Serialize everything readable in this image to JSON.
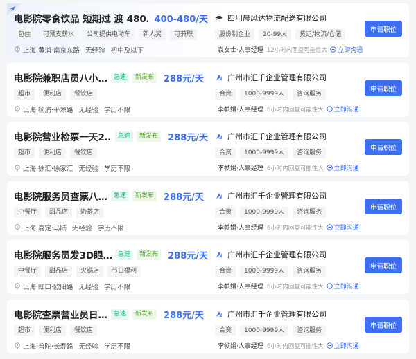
{
  "colors": {
    "accent": "#3d6ff0",
    "fast_badge": "#1fb58a",
    "new_badge": "#55a631"
  },
  "jobs": [
    {
      "title": "电影院零食饮品 短期过 渡 480…",
      "badges": [],
      "salary": "400-480/天",
      "tags": [
        "包住",
        "可预支薪水",
        "公司提供电动车",
        "新人奖",
        "可兼职"
      ],
      "location": "上海·黄浦·南京东路",
      "experience": "无经验",
      "education": "初中及以下",
      "company": "四川晨风达物流配送有限公司",
      "company_tags": [
        "股份制企业",
        "20-99人",
        "货运/物流/仓储"
      ],
      "hr": "袁女士·人事经理",
      "reply": "12小时内回复可能性大",
      "chat": "立即沟通",
      "apply": "申请职位"
    },
    {
      "title": "电影院兼职店员八小…",
      "badges": [
        "急速",
        "新发布"
      ],
      "salary": "288元/天",
      "tags": [
        "超市",
        "便利店",
        "餐饮店"
      ],
      "location": "上海·杨浦·平凉路",
      "experience": "无经验",
      "education": "学历不限",
      "company": "广州市汇千企业管理有限公司",
      "company_tags": [
        "合资",
        "1000-9999人",
        "咨询服务"
      ],
      "hr": "李帧娟·人事经理",
      "reply": "6小时内回复可能性大",
      "chat": "立即沟通",
      "apply": "申请职位"
    },
    {
      "title": "电影院营业检票一天2…",
      "badges": [
        "急速",
        "新发布"
      ],
      "salary": "288元/天",
      "tags": [
        "超市",
        "便利店",
        "餐饮店"
      ],
      "location": "上海·徐汇·徐家汇",
      "experience": "无经验",
      "education": "学历不限",
      "company": "广州市汇千企业管理有限公司",
      "company_tags": [
        "合资",
        "1000-9999人",
        "咨询服务"
      ],
      "hr": "李帧娟·人事经理",
      "reply": "6小时内回复可能性大",
      "chat": "立即沟通",
      "apply": "申请职位"
    },
    {
      "title": "电影院服务员查票八…",
      "badges": [
        "急速",
        "新发布"
      ],
      "salary": "288元/天",
      "tags": [
        "中餐厅",
        "甜品店",
        "奶茶店"
      ],
      "location": "上海·嘉定·马陆",
      "experience": "无经验",
      "education": "学历不限",
      "company": "广州市汇千企业管理有限公司",
      "company_tags": [
        "合资",
        "1000-9999人",
        "咨询服务"
      ],
      "hr": "李帧娟·人事经理",
      "reply": "6小时内回复可能性大",
      "chat": "立即沟通",
      "apply": "申请职位"
    },
    {
      "title": "电影院服务员发3D眼…",
      "badges": [
        "急速",
        "新发布"
      ],
      "salary": "288元/天",
      "tags": [
        "中餐厅",
        "甜品店",
        "火锅店",
        "节日福利"
      ],
      "location": "上海·虹口·欧阳路",
      "experience": "无经验",
      "education": "学历不限",
      "company": "广州市汇千企业管理有限公司",
      "company_tags": [
        "合资",
        "1000-9999人",
        "咨询服务"
      ],
      "hr": "李帧娟·人事经理",
      "reply": "6小时内回复可能性大",
      "chat": "立即沟通",
      "apply": "申请职位"
    },
    {
      "title": "电影院查票营业员日…",
      "badges": [
        "急速",
        "新发布"
      ],
      "salary": "288元/天",
      "tags": [
        "超市",
        "便利店",
        "餐饮店"
      ],
      "location": "上海·普陀·长寿路",
      "experience": "无经验",
      "education": "学历不限",
      "company": "广州市汇千企业管理有限公司",
      "company_tags": [
        "合资",
        "1000-9999人",
        "咨询服务"
      ],
      "hr": "李帧娟·人事经理",
      "reply": "6小时内回复可能性大",
      "chat": "立即沟通",
      "apply": "申请职位"
    }
  ]
}
